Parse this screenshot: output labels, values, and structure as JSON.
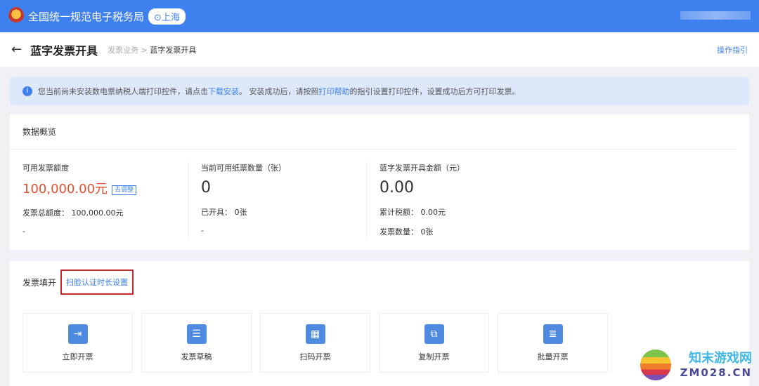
{
  "header": {
    "brand": "全国统一规范电子税务局",
    "location": "上海"
  },
  "titlebar": {
    "title": "蓝字发票开具",
    "crumb_parent": "发票业务",
    "crumb_sep": ">",
    "crumb_current": "蓝字发票开具",
    "guide": "操作指引"
  },
  "notice": {
    "text1": "您当前尚未安装数电票纳税人端打印控件，请点击",
    "link1": "下载安装",
    "text2": "。 安装成功后，请按照",
    "link2": "打印帮助",
    "text3": "的指引设置打印控件，设置成功后方可打印发票。"
  },
  "overview": {
    "title": "数据概览",
    "col1": {
      "label": "可用发票额度",
      "value": "100,000.00元",
      "adjust": "去调整",
      "line1": "发票总额度： 100,000.00元",
      "line2": "-"
    },
    "col2": {
      "label": "当前可用纸票数量（张）",
      "value": "0",
      "line1": "已开具： 0张",
      "line2": "-"
    },
    "col3": {
      "label": "蓝字发票开具金额（元）",
      "value": "0.00",
      "line1": "累计税额： 0.00元",
      "line2": "发票数量： 0张"
    }
  },
  "fill": {
    "title": "发票填开",
    "face_setting": "扫脸认证时长设置",
    "tiles": [
      {
        "label": "立即开票"
      },
      {
        "label": "发票草稿"
      },
      {
        "label": "扫码开票"
      },
      {
        "label": "复制开票"
      },
      {
        "label": "批量开票"
      }
    ]
  },
  "watermark": {
    "line1": "知末游戏网",
    "line2": "ZM028.CN"
  }
}
